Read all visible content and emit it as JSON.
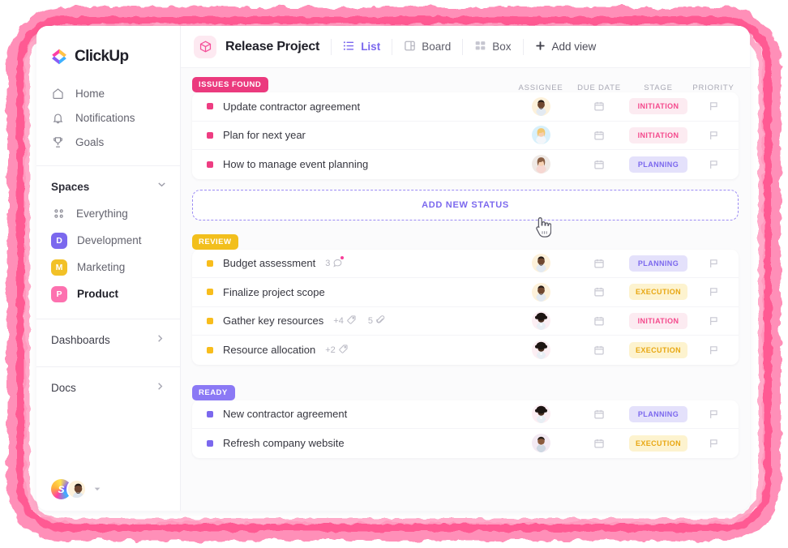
{
  "frame": {
    "accent": "#ff5a93",
    "accent_light": "#ff8fb8"
  },
  "sidebar": {
    "logo_text": "ClickUp",
    "nav": [
      {
        "label": "Home",
        "icon": "home-icon"
      },
      {
        "label": "Notifications",
        "icon": "bell-icon"
      },
      {
        "label": "Goals",
        "icon": "trophy-icon"
      }
    ],
    "spaces_header": "Spaces",
    "spaces": [
      {
        "label": "Everything",
        "icon": "grid-dots-icon",
        "initial": "",
        "color": "",
        "active": false
      },
      {
        "label": "Development",
        "initial": "D",
        "color": "#7b68ee",
        "active": false
      },
      {
        "label": "Marketing",
        "initial": "M",
        "color": "#f2c127",
        "active": false
      },
      {
        "label": "Product",
        "initial": "P",
        "color": "#fd71af",
        "active": true
      }
    ],
    "bottom_links": [
      {
        "label": "Dashboards",
        "icon": "chevron-right-icon"
      },
      {
        "label": "Docs",
        "icon": "chevron-right-icon"
      }
    ],
    "user_strip": {
      "workspace_initial": "S",
      "avatar_name": "user-avatar",
      "caret": "caret-down-icon"
    }
  },
  "topbar": {
    "project_icon": "cube-icon",
    "project_title": "Release Project",
    "views": [
      {
        "label": "List",
        "icon": "list-icon",
        "active": true
      },
      {
        "label": "Board",
        "icon": "board-icon",
        "active": false
      },
      {
        "label": "Box",
        "icon": "box-icon",
        "active": false
      }
    ],
    "add_view": {
      "label": "Add view",
      "icon": "plus-icon"
    }
  },
  "table": {
    "columns": [
      {
        "label": "ASSIGNEE"
      },
      {
        "label": "DUE DATE"
      },
      {
        "label": "STAGE"
      },
      {
        "label": "PRIORITY"
      }
    ],
    "add_status_label": "ADD NEW STATUS",
    "groups": [
      {
        "status": "ISSUES FOUND",
        "status_bg": "#eb3a7e",
        "dot": "#ee3d82",
        "tasks": [
          {
            "title": "Update contractor agreement",
            "comments": "",
            "tags": "",
            "attachments": "",
            "avatar": "avatar-1",
            "due": "calendar-icon",
            "stage": "INITIATION",
            "stage_bg": "#fcebf1",
            "stage_fg": "#f4498c",
            "priority": "flag-icon"
          },
          {
            "title": "Plan for next year",
            "comments": "",
            "tags": "",
            "attachments": "",
            "avatar": "avatar-2",
            "due": "calendar-icon",
            "stage": "INITIATION",
            "stage_bg": "#fcebf1",
            "stage_fg": "#f4498c",
            "priority": "flag-icon"
          },
          {
            "title": "How to manage event planning",
            "comments": "",
            "tags": "",
            "attachments": "",
            "avatar": "avatar-3",
            "due": "calendar-icon",
            "stage": "PLANNING",
            "stage_bg": "#e4e1fb",
            "stage_fg": "#7b68ee",
            "priority": "flag-icon"
          }
        ]
      },
      {
        "status": "REVIEW",
        "status_bg": "#f2bf1c",
        "dot": "#f8bd1c",
        "tasks": [
          {
            "title": "Budget assessment",
            "comments": "3",
            "tags": "",
            "attachments": "",
            "avatar": "avatar-1",
            "due": "calendar-icon",
            "stage": "PLANNING",
            "stage_bg": "#e4e1fb",
            "stage_fg": "#7b68ee",
            "priority": "flag-icon"
          },
          {
            "title": "Finalize project scope",
            "comments": "",
            "tags": "",
            "attachments": "",
            "avatar": "avatar-1",
            "due": "calendar-icon",
            "stage": "EXECUTION",
            "stage_bg": "#fdf3cf",
            "stage_fg": "#e8a712",
            "priority": "flag-icon"
          },
          {
            "title": "Gather key resources",
            "comments": "",
            "tags": "+4",
            "attachments": "5",
            "avatar": "avatar-4",
            "due": "calendar-icon",
            "stage": "INITIATION",
            "stage_bg": "#fcebf1",
            "stage_fg": "#f4498c",
            "priority": "flag-icon"
          },
          {
            "title": "Resource allocation",
            "comments": "",
            "tags": "+2",
            "attachments": "",
            "avatar": "avatar-4",
            "due": "calendar-icon",
            "stage": "EXECUTION",
            "stage_bg": "#fdf3cf",
            "stage_fg": "#e8a712",
            "priority": "flag-icon"
          }
        ]
      },
      {
        "status": "READY",
        "status_bg": "#8b79f5",
        "dot": "#7b68ee",
        "tasks": [
          {
            "title": "New contractor agreement",
            "comments": "",
            "tags": "",
            "attachments": "",
            "avatar": "avatar-4",
            "due": "calendar-icon",
            "stage": "PLANNING",
            "stage_bg": "#e4e1fb",
            "stage_fg": "#7b68ee",
            "priority": "flag-icon"
          },
          {
            "title": "Refresh company website",
            "comments": "",
            "tags": "",
            "attachments": "",
            "avatar": "avatar-5",
            "due": "calendar-icon",
            "stage": "EXECUTION",
            "stage_bg": "#fdf3cf",
            "stage_fg": "#e8a712",
            "priority": "flag-icon"
          }
        ]
      }
    ]
  },
  "cursor": {
    "icon": "pointing-hand-cursor"
  }
}
